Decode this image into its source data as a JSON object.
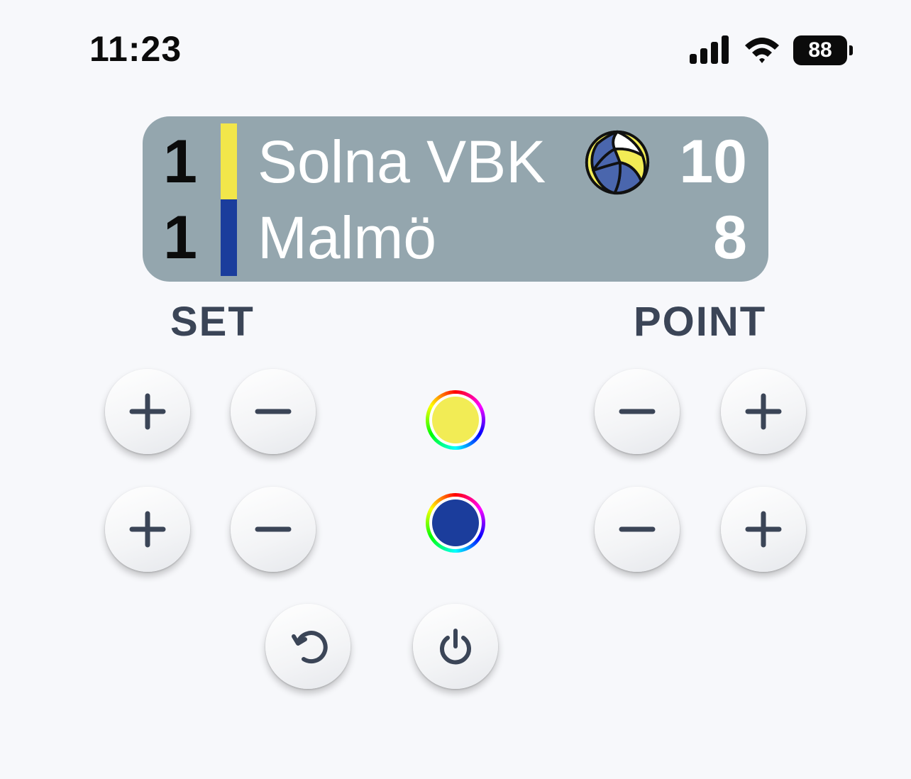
{
  "status_bar": {
    "time": "11:23",
    "battery": "88",
    "icons": [
      "signal-icon",
      "wifi-icon",
      "battery-icon"
    ]
  },
  "scoreboard": {
    "teams": [
      {
        "sets": "1",
        "name": "Solna VBK",
        "points": "10",
        "color": "#f2e64a",
        "serving": true
      },
      {
        "sets": "1",
        "name": "Malmö",
        "points": "8",
        "color": "#1b3d9c",
        "serving": false
      }
    ],
    "serve_icon": "volleyball-icon",
    "background": "#94a6ae"
  },
  "labels": {
    "set": "SET",
    "point": "POINT"
  },
  "controls": {
    "plus_symbol": "+",
    "minus_symbol": "−",
    "reset_icon": "undo-icon",
    "power_icon": "power-icon",
    "color_pickers": [
      {
        "team": "Solna VBK",
        "color": "#f2ec55"
      },
      {
        "team": "Malmö",
        "color": "#1b3d9c"
      }
    ]
  }
}
